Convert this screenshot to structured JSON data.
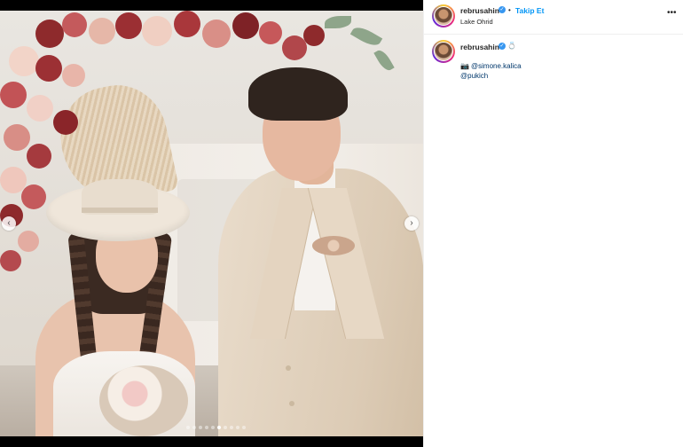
{
  "post": {
    "username": "rebrusahin",
    "follow_label": "Takip Et",
    "separator": "•",
    "location": "Lake Ohrid",
    "more_label": "•••",
    "caption": {
      "username": "rebrusahin",
      "emoji": "💍",
      "camera_emoji": "📷",
      "credit1": "@simone.kalica",
      "credit2": "@pukich"
    }
  },
  "carousel": {
    "prev_label": "‹",
    "next_label": "›",
    "total": 10,
    "active_index": 5
  },
  "colors": {
    "verified": "#3897f0",
    "link": "#0095f6",
    "mention": "#00376b"
  },
  "icons": {
    "verified": "verified-badge-icon",
    "more": "more-options-icon",
    "camera": "camera-icon"
  }
}
